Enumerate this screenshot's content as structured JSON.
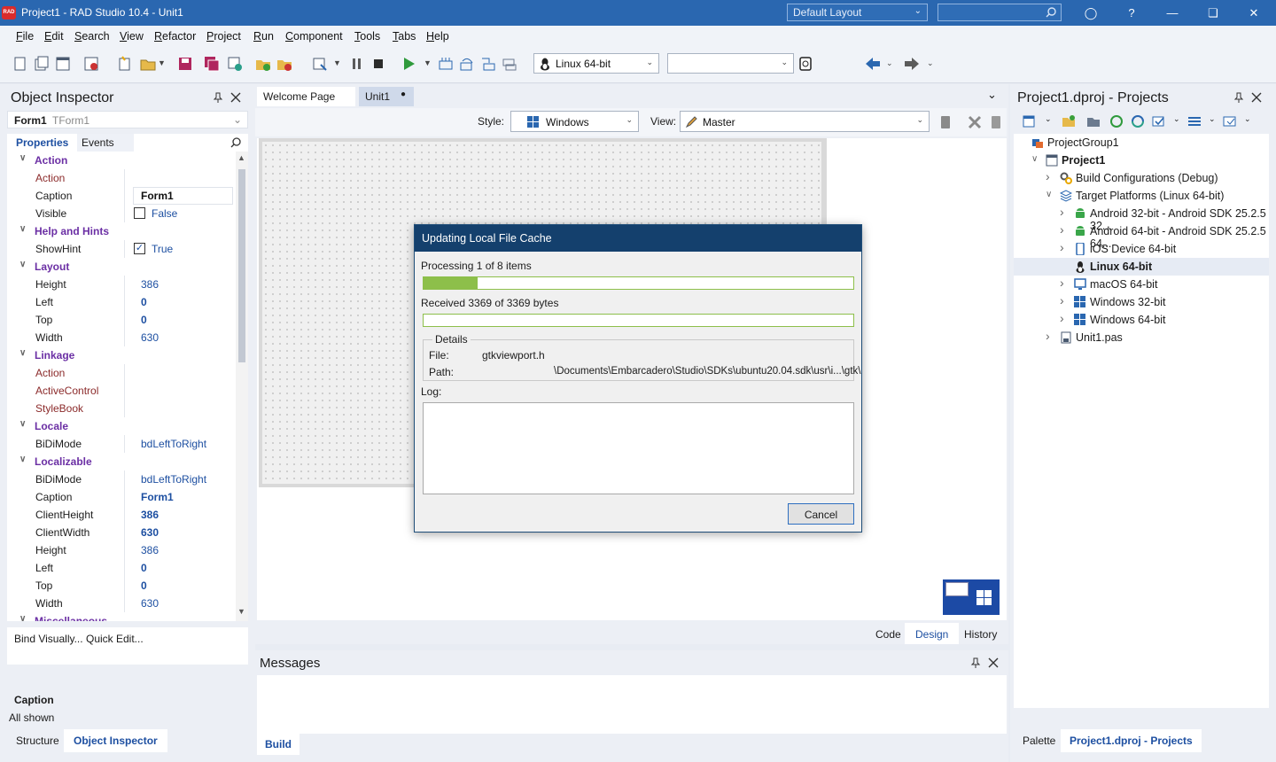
{
  "window": {
    "title": "Project1 - RAD Studio 10.4 - Unit1",
    "logo_text": "RAD",
    "layout_combo": "Default Layout",
    "search_placeholder": ""
  },
  "menu": [
    {
      "u": "F",
      "rest": "ile"
    },
    {
      "u": "E",
      "rest": "dit"
    },
    {
      "u": "S",
      "rest": "earch"
    },
    {
      "u": "V",
      "rest": "iew"
    },
    {
      "u": "R",
      "rest": "efactor"
    },
    {
      "u": "P",
      "rest": "roject"
    },
    {
      "u": "R",
      "rest": "un"
    },
    {
      "u": "C",
      "rest": "omponent"
    },
    {
      "u": "T",
      "rest": "ools"
    },
    {
      "u": "T",
      "rest": "abs"
    },
    {
      "u": "H",
      "rest": "elp"
    }
  ],
  "toolbar": {
    "platform": "Linux 64-bit",
    "config": ""
  },
  "object_inspector": {
    "title": "Object Inspector",
    "selected": {
      "name": "Form1",
      "type": "TForm1"
    },
    "tabs": [
      "Properties",
      "Events"
    ],
    "rows": [
      {
        "kind": "cat",
        "k": "Action"
      },
      {
        "kind": "prop",
        "k": "Action",
        "v": "",
        "kc": "red"
      },
      {
        "kind": "prop",
        "k": "Caption",
        "v": "Form1",
        "vc": "bold sel"
      },
      {
        "kind": "check",
        "k": "Visible",
        "v": "False",
        "checked": false
      },
      {
        "kind": "cat",
        "k": "Help and Hints"
      },
      {
        "kind": "check",
        "k": "ShowHint",
        "v": "True",
        "checked": true
      },
      {
        "kind": "cat",
        "k": "Layout"
      },
      {
        "kind": "prop",
        "k": "Height",
        "v": "386",
        "vc": "blue"
      },
      {
        "kind": "prop",
        "k": "Left",
        "v": "0",
        "vc": "blue bold"
      },
      {
        "kind": "prop",
        "k": "Top",
        "v": "0",
        "vc": "blue bold"
      },
      {
        "kind": "prop",
        "k": "Width",
        "v": "630",
        "vc": "blue"
      },
      {
        "kind": "cat",
        "k": "Linkage"
      },
      {
        "kind": "prop",
        "k": "Action",
        "v": "",
        "kc": "red"
      },
      {
        "kind": "prop",
        "k": "ActiveControl",
        "v": "",
        "kc": "red"
      },
      {
        "kind": "prop",
        "k": "StyleBook",
        "v": "",
        "kc": "red"
      },
      {
        "kind": "cat",
        "k": "Locale"
      },
      {
        "kind": "prop",
        "k": "BiDiMode",
        "v": "bdLeftToRight",
        "vc": "blue"
      },
      {
        "kind": "cat",
        "k": "Localizable"
      },
      {
        "kind": "prop",
        "k": "BiDiMode",
        "v": "bdLeftToRight",
        "vc": "blue"
      },
      {
        "kind": "prop",
        "k": "Caption",
        "v": "Form1",
        "vc": "blue bold"
      },
      {
        "kind": "prop",
        "k": "ClientHeight",
        "v": "386",
        "vc": "blue bold"
      },
      {
        "kind": "prop",
        "k": "ClientWidth",
        "v": "630",
        "vc": "blue bold"
      },
      {
        "kind": "prop",
        "k": "Height",
        "v": "386",
        "vc": "blue"
      },
      {
        "kind": "prop",
        "k": "Left",
        "v": "0",
        "vc": "blue bold"
      },
      {
        "kind": "prop",
        "k": "Top",
        "v": "0",
        "vc": "blue bold"
      },
      {
        "kind": "prop",
        "k": "Width",
        "v": "630",
        "vc": "blue"
      },
      {
        "kind": "cat",
        "k": "Miscellaneous"
      }
    ],
    "bind_visually": "Bind Visually...",
    "quick_edit": "Quick Edit...",
    "desc_title": "Caption",
    "desc_text": "All shown",
    "bottom_tabs": [
      "Structure",
      "Object Inspector"
    ]
  },
  "editor": {
    "tabs": [
      "Welcome Page",
      "Unit1"
    ],
    "style_label": "Style:",
    "style_value": "Windows",
    "view_label": "View:",
    "view_value": "Master",
    "bottom_tabs": [
      "Code",
      "Design",
      "History"
    ]
  },
  "messages": {
    "title": "Messages",
    "tab": "Build"
  },
  "projects": {
    "title": "Project1.dproj - Projects",
    "tree": [
      {
        "label": "ProjectGroup1",
        "indent": 0,
        "icon": "project-group-icon",
        "exp": ""
      },
      {
        "label": "Project1",
        "indent": 1,
        "icon": "project-icon",
        "exp": "v",
        "bold": true
      },
      {
        "label": "Build Configurations (Debug)",
        "indent": 2,
        "icon": "gears-icon",
        "exp": ">"
      },
      {
        "label": "Target Platforms (Linux 64-bit)",
        "indent": 2,
        "icon": "platforms-icon",
        "exp": "v"
      },
      {
        "label": "Android 32-bit - Android SDK 25.2.5 32...",
        "indent": 3,
        "icon": "android-icon",
        "exp": ">"
      },
      {
        "label": "Android 64-bit - Android SDK 25.2.5 64...",
        "indent": 3,
        "icon": "android-icon",
        "exp": ">"
      },
      {
        "label": "iOS Device 64-bit",
        "indent": 3,
        "icon": "ios-device-icon",
        "exp": ">"
      },
      {
        "label": "Linux 64-bit",
        "indent": 3,
        "icon": "linux-icon",
        "exp": "",
        "bold": true,
        "selected": true
      },
      {
        "label": "macOS 64-bit",
        "indent": 3,
        "icon": "macos-icon",
        "exp": ">"
      },
      {
        "label": "Windows 32-bit",
        "indent": 3,
        "icon": "windows-icon",
        "exp": ">"
      },
      {
        "label": "Windows 64-bit",
        "indent": 3,
        "icon": "windows-icon",
        "exp": ">"
      },
      {
        "label": "Unit1.pas",
        "indent": 2,
        "icon": "unit-file-icon",
        "exp": ">"
      }
    ],
    "bottom_tabs": [
      "Palette",
      "Project1.dproj - Projects"
    ]
  },
  "dialog": {
    "title": "Updating Local File Cache",
    "processing": "Processing 1 of 8 items",
    "progress_items": 0.125,
    "received": "Received 3369 of 3369 bytes",
    "progress_bytes": 0.0,
    "details_label": "Details",
    "file_label": "File:",
    "file_value": "gtkviewport.h",
    "path_label": "Path:",
    "path_value": "\\Documents\\Embarcadero\\Studio\\SDKs\\ubuntu20.04.sdk\\usr\\i...\\gtk\\",
    "log_label": "Log:",
    "cancel": "Cancel"
  },
  "colors": {
    "titlebar": "#2a67b0",
    "dialog_title": "#14406d",
    "progress": "#8dbf4a",
    "accent": "#1d4fa1"
  }
}
